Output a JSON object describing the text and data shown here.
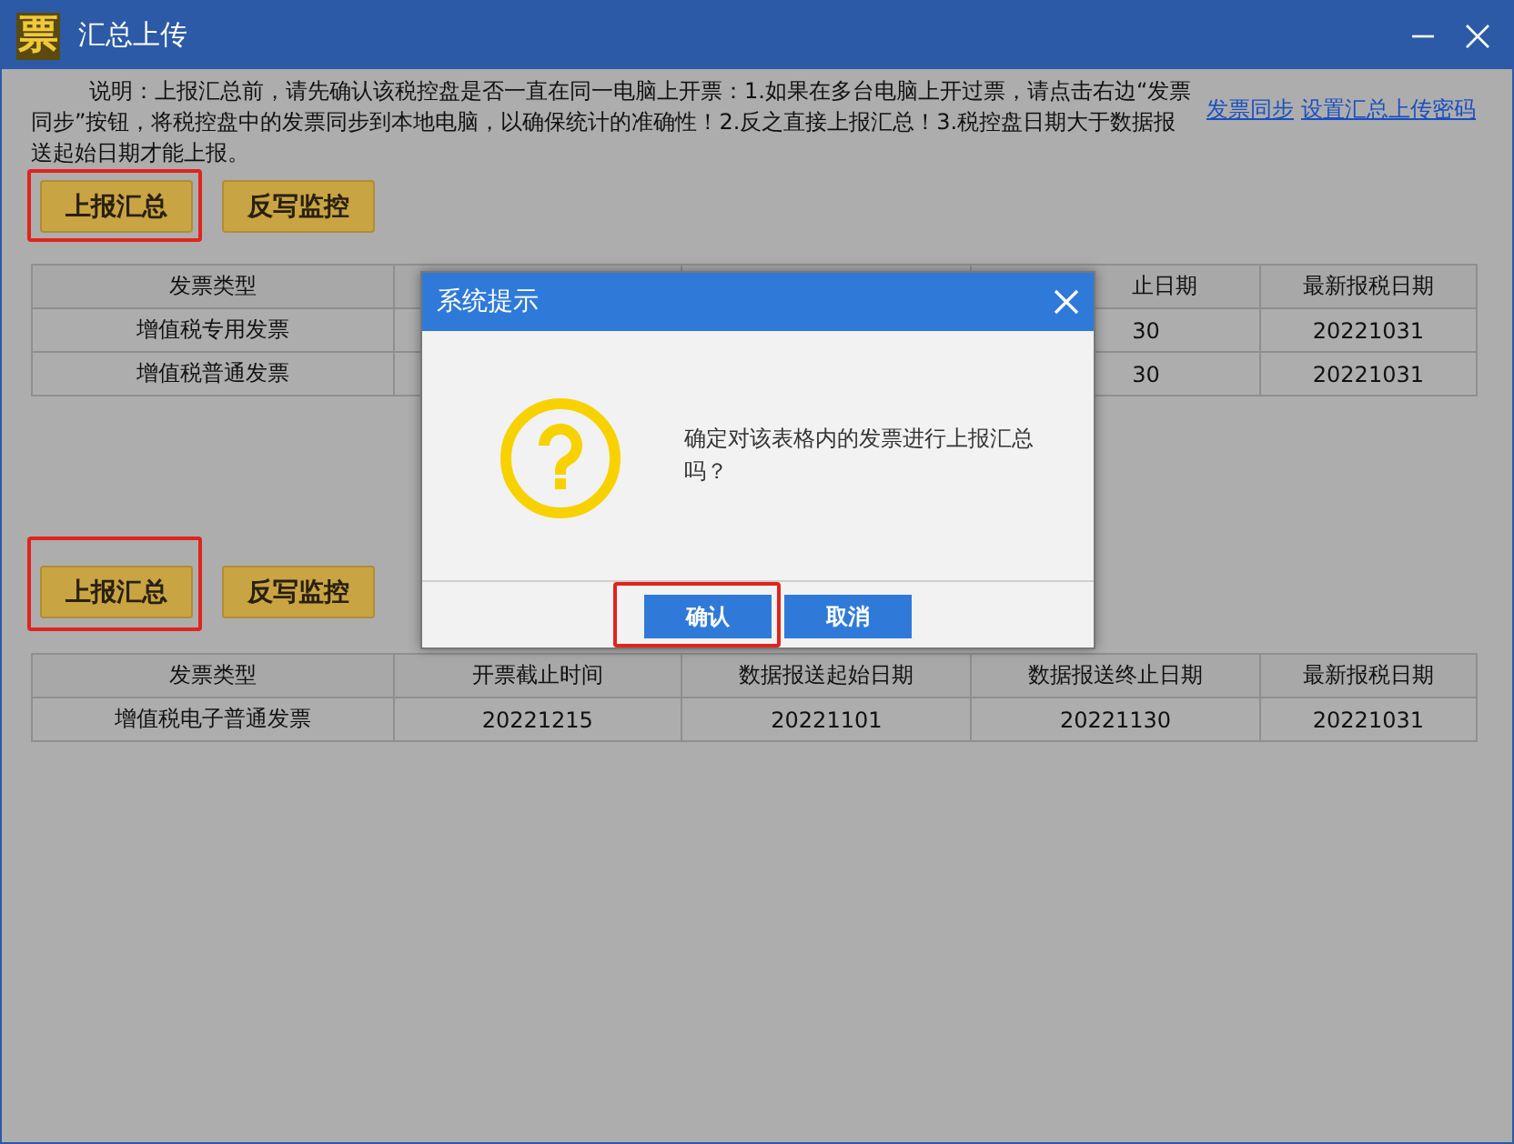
{
  "window": {
    "logo": "票",
    "title": "汇总上传"
  },
  "notice": {
    "text": "说明：上报汇总前，请先确认该税控盘是否一直在同一电脑上开票：1.如果在多台电脑上开过票，请点击右边“发票同步”按钮，将税控盘中的发票同步到本地电脑，以确保统计的准确性！2.反之直接上报汇总！3.税控盘日期大于数据报送起始日期才能上报。",
    "links": [
      "发票同步",
      "设置汇总上传密码"
    ]
  },
  "sections": [
    {
      "buttons": [
        {
          "label": "上报汇总",
          "highlighted": true
        },
        {
          "label": "反写监控",
          "highlighted": false
        }
      ],
      "table": {
        "partly_covered": true,
        "columns": [
          "发票类型",
          "止日期",
          "最新报税日期"
        ],
        "rows": [
          [
            "增值税专用发票",
            "30",
            "20221031"
          ],
          [
            "增值税普通发票",
            "30",
            "20221031"
          ]
        ]
      }
    },
    {
      "buttons": [
        {
          "label": "上报汇总",
          "highlighted": true
        },
        {
          "label": "反写监控",
          "highlighted": false
        }
      ],
      "table": {
        "partly_covered": false,
        "columns": [
          "发票类型",
          "开票截止时间",
          "数据报送起始日期",
          "数据报送终止日期",
          "最新报税日期"
        ],
        "rows": [
          [
            "增值税电子普通发票",
            "20221215",
            "20221101",
            "20221130",
            "20221031"
          ]
        ]
      }
    }
  ],
  "dialog": {
    "title": "系统提示",
    "message": "确定对该表格内的发票进行上报汇总吗？",
    "buttons": [
      {
        "label": "确认",
        "highlighted": true
      },
      {
        "label": "取消",
        "highlighted": false
      }
    ]
  }
}
